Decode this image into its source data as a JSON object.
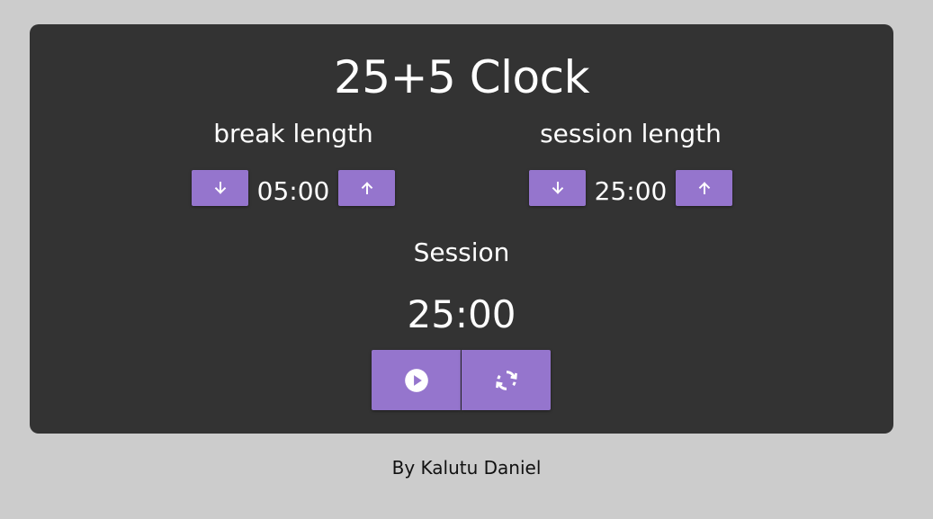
{
  "app": {
    "title": "25+5 Clock"
  },
  "break_length": {
    "label": "break length",
    "value": "05:00",
    "decrement_icon": "arrow-down-icon",
    "increment_icon": "arrow-up-icon"
  },
  "session_length": {
    "label": "session length",
    "value": "25:00",
    "decrement_icon": "arrow-down-icon",
    "increment_icon": "arrow-up-icon"
  },
  "timer": {
    "label": "Session",
    "value": "25:00"
  },
  "controls": {
    "start_stop_icon": "play-circle-icon",
    "reset_icon": "refresh-icon"
  },
  "footer": {
    "text": "By Kalutu Daniel"
  },
  "colors": {
    "page_background": "#cccccc",
    "card_background": "#333333",
    "accent": "#9575cd",
    "text": "#ffffff"
  }
}
